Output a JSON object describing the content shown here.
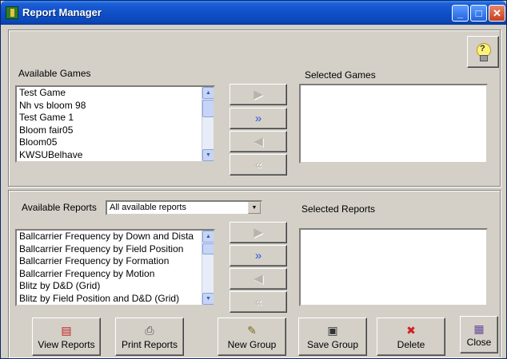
{
  "window": {
    "title": "Report Manager",
    "controls": {
      "minimize": "_",
      "maximize": "□",
      "close": "✕"
    }
  },
  "games": {
    "available_label": "Available Games",
    "selected_label": "Selected Games",
    "items": [
      "Test Game",
      "Nh vs bloom 98",
      "Test Game 1",
      "Bloom fair05",
      "Bloom05",
      "KWSUBelhave"
    ],
    "selected_items": []
  },
  "reports": {
    "available_label": "Available Reports",
    "filter_value": "All available reports",
    "selected_label": "Selected Reports",
    "items": [
      "Ballcarrier Frequency by Down and Dista",
      "Ballcarrier Frequency by Field Position",
      "Ballcarrier Frequency by Formation",
      "Ballcarrier Frequency by Motion",
      "Blitz by D&D (Grid)",
      "Blitz by Field Position and D&D (Grid)"
    ],
    "selected_items": []
  },
  "transfer_buttons": {
    "add_one": "▶",
    "add_all": "»",
    "remove_one": "◀",
    "remove_all": "«"
  },
  "actions": {
    "view_reports": "View Reports",
    "print_reports": "Print Reports",
    "new_group": "New Group",
    "save_group": "Save Group",
    "delete": "Delete",
    "close": "Close"
  },
  "icons": {
    "help": "lightbulb-help-icon",
    "view": "report-view-icon",
    "print": "printer-icon",
    "new": "new-document-icon",
    "save": "floppy-disk-icon",
    "delete": "delete-document-icon",
    "close": "close-window-icon"
  },
  "colors": {
    "window_bg": "#d4d0c8",
    "titlebar": "#0f4fc8",
    "active_arrow": "#2c5ad8"
  }
}
